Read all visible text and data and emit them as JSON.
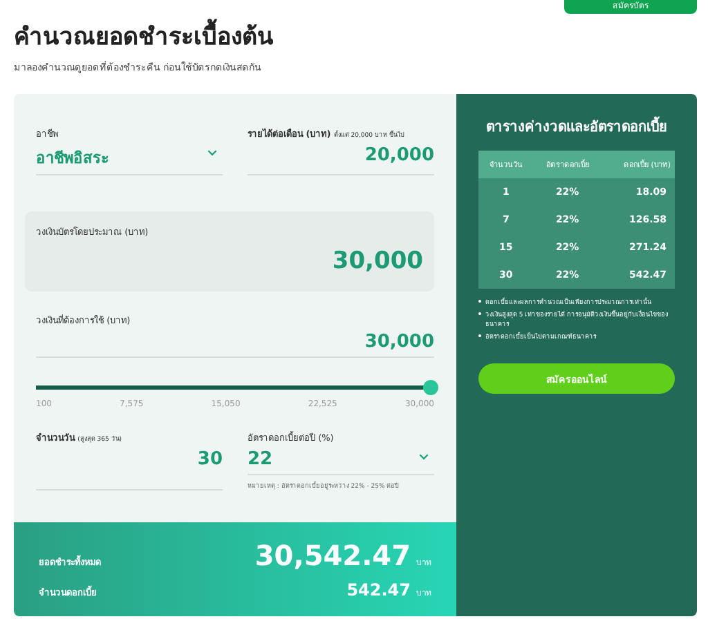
{
  "header": {
    "button": "สมัครบัตร",
    "title": "คำนวณยอดชำระเบื้องต้น",
    "subtitle": "มาลองคำนวณดูยอดที่ต้องชำระคืน ก่อนใช้บัตรกดเงินสดกัน"
  },
  "calculator": {
    "occupation": {
      "label": "อาชีพ",
      "value": "อาชีพอิสระ"
    },
    "income": {
      "label": "รายได้ต่อเดือน (บาท)",
      "hint": "ตั้งแต่ 20,000 บาท ขึ้นไป",
      "value": "20,000"
    },
    "card_limit": {
      "label": "วงเงินบัตรโดยประมาณ (บาท)",
      "value": "30,000"
    },
    "amount": {
      "label": "วงเงินที่ต้องการใช้ (บาท)",
      "value": "30,000",
      "level": 1,
      "ticks": [
        "100",
        "7,575",
        "15,050",
        "22,525",
        "30,000"
      ]
    },
    "days": {
      "label": "จำนวนวัน",
      "hint": "(สูงสุด 365 วัน)",
      "value": "30"
    },
    "rate": {
      "label": "อัตราดอกเบี้ยต่อปี (%)",
      "value": "22",
      "note": "หมายเหตุ : อัตราดอกเบี้ยอยู่ระหว่าง 22% - 25% ต่อปี"
    }
  },
  "summary": {
    "total": {
      "label": "ยอดชำระทั้งหมด",
      "value": "30,542.47",
      "unit": "บาท"
    },
    "interest": {
      "label": "จำนวนดอกเบี้ย",
      "value": "542.47",
      "unit": "บาท"
    }
  },
  "side_panel": {
    "title": "ตารางค่างวดและอัตราดอกเบี้ย",
    "table": {
      "columns": [
        "จำนวนวัน",
        "อัตราดอกเบี้ย",
        "ดอกเบี้ย (บาท)"
      ],
      "rows": [
        [
          "1",
          "22%",
          "18.09"
        ],
        [
          "7",
          "22%",
          "126.58"
        ],
        [
          "15",
          "22%",
          "271.24"
        ],
        [
          "30",
          "22%",
          "542.47"
        ]
      ]
    },
    "notes": [
      "ดอกเบี้ยและผลการคำนวณเป็นเพียงการประมาณการเท่านั้น",
      "วงเงินสูงสุด 5 เท่าของรายได้ การอนุมัติวงเงินขึ้นอยู่กับเงื่อนไขของธนาคาร",
      "อัตราดอกเบี้ยเป็นไปตามเกณฑ์ธนาคาร"
    ],
    "button": "สมัครออนไลน์"
  }
}
